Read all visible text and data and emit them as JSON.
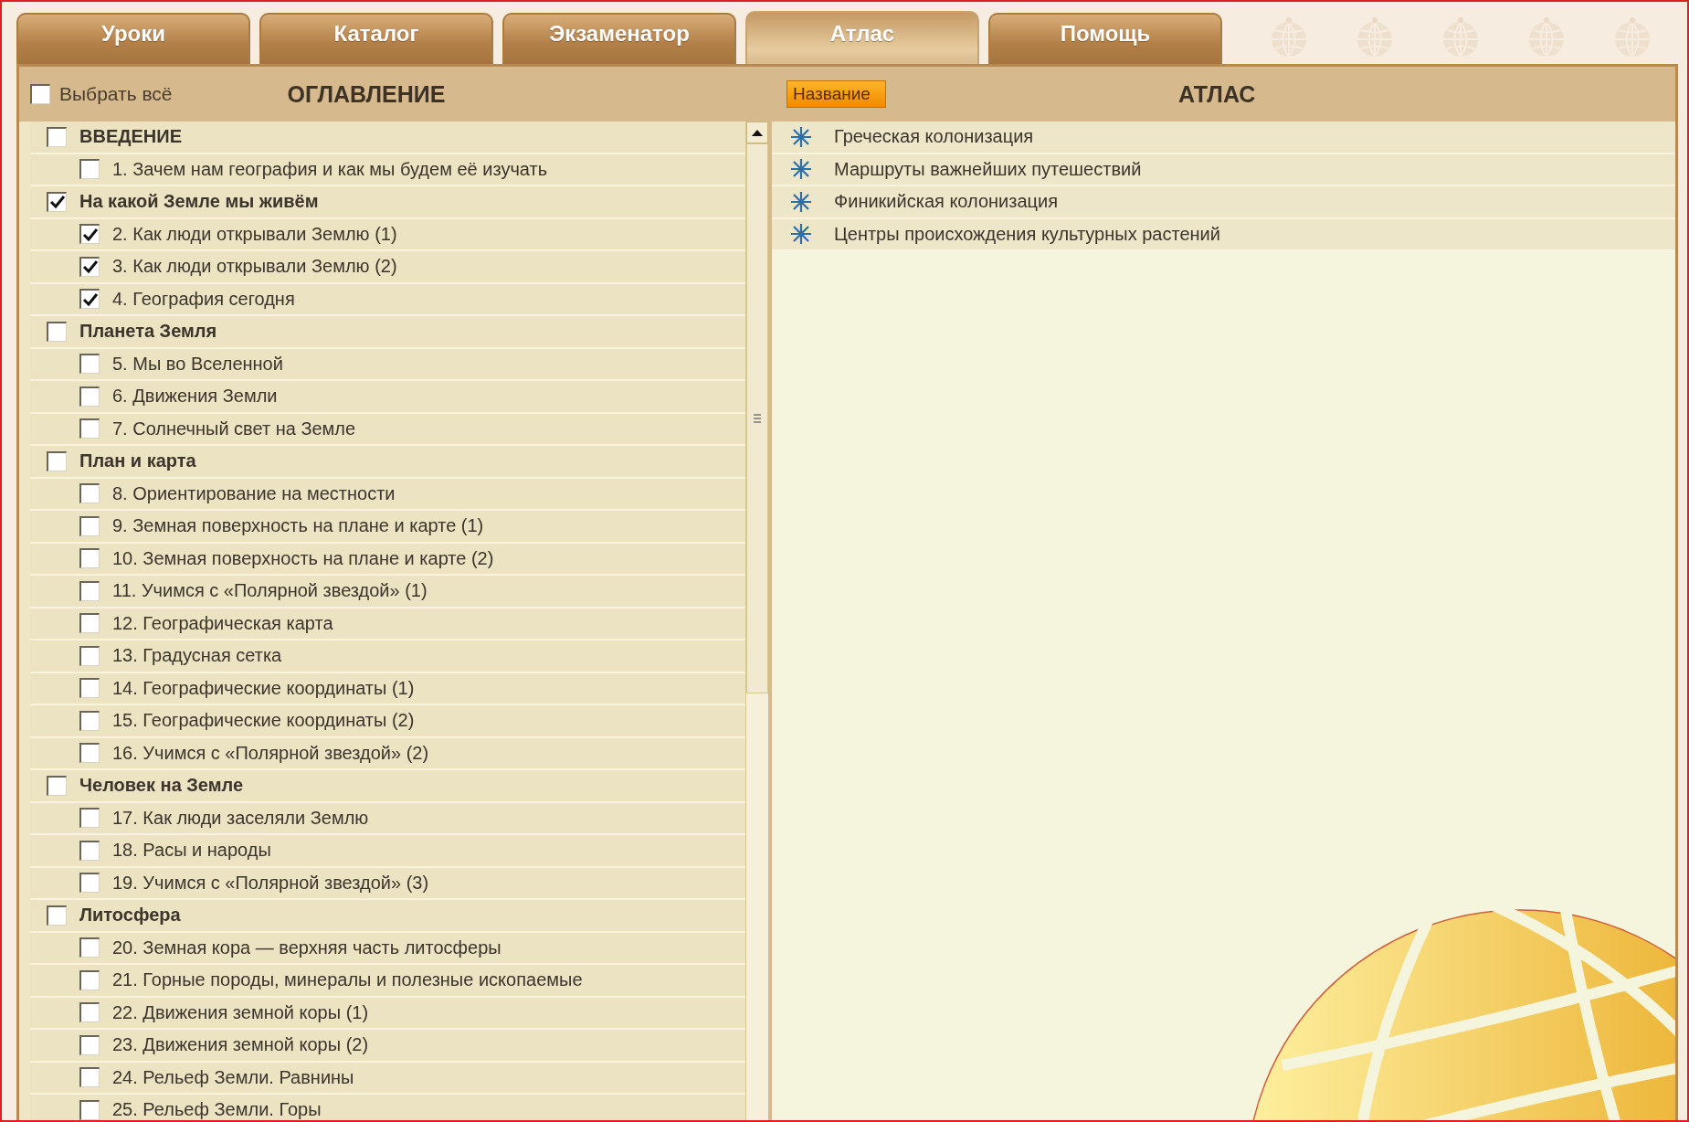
{
  "tabs": [
    {
      "label": "Уроки",
      "selected": false
    },
    {
      "label": "Каталог",
      "selected": false
    },
    {
      "label": "Экзаменатор",
      "selected": false
    },
    {
      "label": "Атлас",
      "selected": true
    },
    {
      "label": "Помощь",
      "selected": false
    }
  ],
  "contents": {
    "select_all": {
      "label": "Выбрать всё",
      "checked": false
    },
    "title": "ОГЛАВЛЕНИЕ",
    "sections": [
      {
        "label": "ВВЕДЕНИЕ",
        "checked": false,
        "children": [
          {
            "label": "1. Зачем нам география и как мы будем её изучать",
            "checked": false
          }
        ]
      },
      {
        "label": "На какой Земле мы живём",
        "checked": true,
        "children": [
          {
            "label": "2. Как люди открывали Землю (1)",
            "checked": true
          },
          {
            "label": "3. Как люди открывали Землю (2)",
            "checked": true
          },
          {
            "label": "4. География сегодня",
            "checked": true
          }
        ]
      },
      {
        "label": "Планета Земля",
        "checked": false,
        "children": [
          {
            "label": "5. Мы во Вселенной",
            "checked": false
          },
          {
            "label": "6. Движения Земли",
            "checked": false
          },
          {
            "label": "7. Солнечный свет на Земле",
            "checked": false
          }
        ]
      },
      {
        "label": "План и карта",
        "checked": false,
        "children": [
          {
            "label": "8. Ориентирование на местности",
            "checked": false
          },
          {
            "label": "9. Земная поверхность на плане и карте (1)",
            "checked": false
          },
          {
            "label": "10. Земная поверхность на плане и карте (2)",
            "checked": false
          },
          {
            "label": "11. Учимся с «Полярной звездой» (1)",
            "checked": false
          },
          {
            "label": "12. Географическая карта",
            "checked": false
          },
          {
            "label": "13. Градусная сетка",
            "checked": false
          },
          {
            "label": "14. Географические координаты (1)",
            "checked": false
          },
          {
            "label": "15. Географические координаты (2)",
            "checked": false
          },
          {
            "label": "16. Учимся с «Полярной звездой» (2)",
            "checked": false
          }
        ]
      },
      {
        "label": "Человек на Земле",
        "checked": false,
        "children": [
          {
            "label": "17. Как люди заселяли Землю",
            "checked": false
          },
          {
            "label": "18. Расы и народы",
            "checked": false
          },
          {
            "label": "19. Учимся с «Полярной звездой» (3)",
            "checked": false
          }
        ]
      },
      {
        "label": "Литосфера",
        "checked": false,
        "children": [
          {
            "label": "20. Земная кора — верхняя часть литосферы",
            "checked": false
          },
          {
            "label": "21. Горные породы, минералы и полезные ископаемые",
            "checked": false
          },
          {
            "label": "22. Движения земной коры (1)",
            "checked": false
          },
          {
            "label": "23. Движения земной коры (2)",
            "checked": false
          },
          {
            "label": "24. Рельеф Земли. Равнины",
            "checked": false
          },
          {
            "label": "25. Рельеф Земли. Горы",
            "checked": false
          }
        ]
      }
    ]
  },
  "atlas": {
    "sort_button": "Название",
    "title": "АТЛАС",
    "items": [
      "Греческая колонизация",
      "Маршруты важнейших путешествий",
      "Финикийская колонизация",
      "Центры происхождения культурных растений"
    ]
  }
}
